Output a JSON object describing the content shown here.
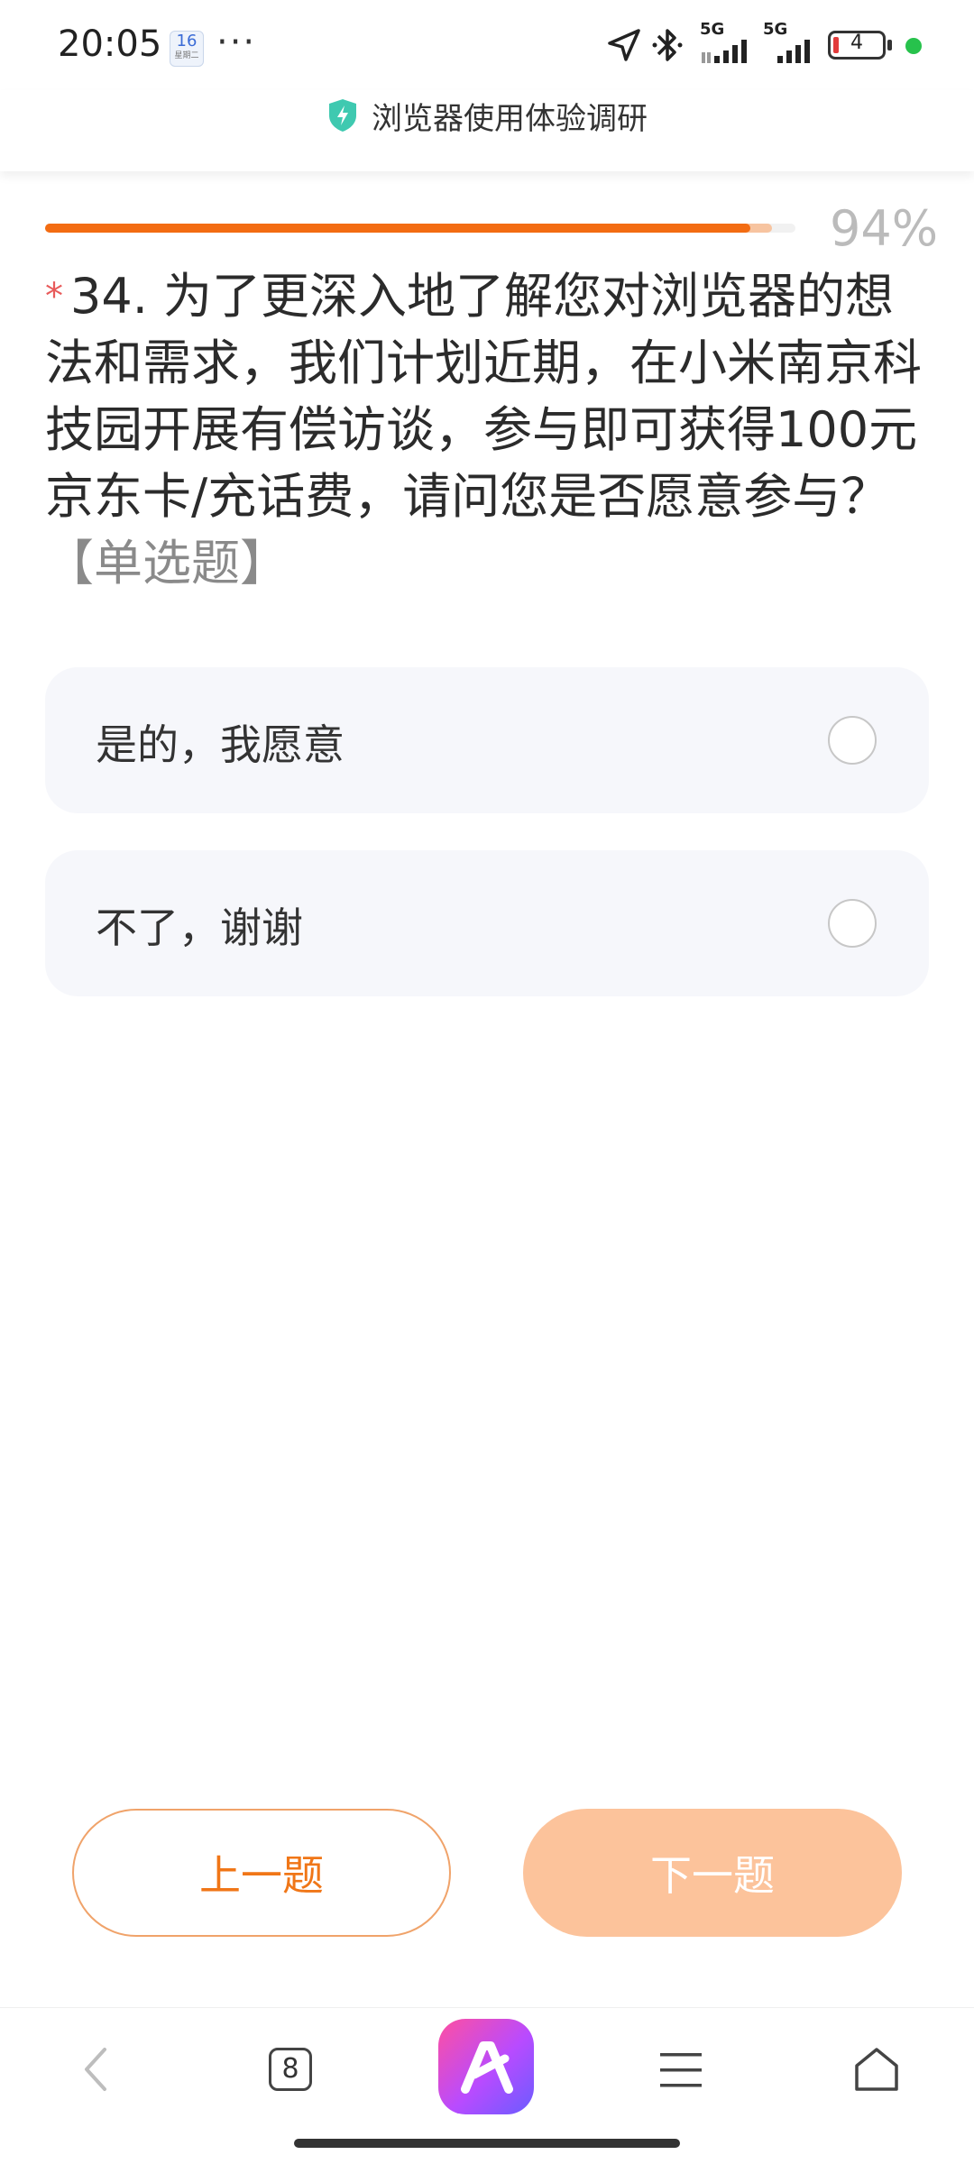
{
  "status_bar": {
    "time": "20:05",
    "calendar_day": "16",
    "calendar_sub": "星期二",
    "overflow": "···",
    "battery_level": "4",
    "network_1": "5G",
    "network_2": "5G"
  },
  "header": {
    "title": "浏览器使用体验调研"
  },
  "progress": {
    "percent_label": "94%",
    "value": 0.94
  },
  "question": {
    "required_mark": "*",
    "text": "34. 为了更深入地了解您对浏览器的想法和需求，我们计划近期，在小米南京科技园开展有偿访谈，参与即可获得100元京东卡/充话费，请问您是否愿意参与？",
    "type_tag": "【单选题】"
  },
  "options": [
    {
      "label": "是的，我愿意",
      "selected": false
    },
    {
      "label": "不了，谢谢",
      "selected": false
    }
  ],
  "buttons": {
    "prev_label": "上一题",
    "next_label": "下一题"
  },
  "bottom_nav": {
    "tab_count": "8",
    "icons": [
      "back-icon",
      "tabs-icon",
      "ai-assistant-icon",
      "menu-icon",
      "home-icon"
    ]
  },
  "colors": {
    "accent": "#f36c12",
    "next_button": "#fcc39b",
    "option_bg": "#f6f7fb",
    "required": "#e85b5b"
  }
}
